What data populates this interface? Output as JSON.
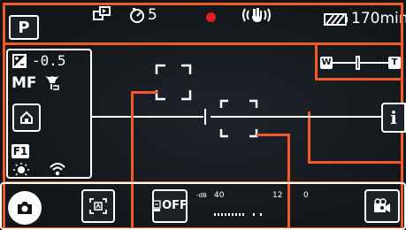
{
  "header": {
    "mode": "P",
    "self_timer": "5",
    "battery_time": "170min"
  },
  "left_panel": {
    "exposure_value": "-0.5",
    "focus_mode": "MF",
    "flash_label": "F1"
  },
  "zoom": {
    "wide_label": "W",
    "tele_label": "T"
  },
  "info_button": {
    "label": "i"
  },
  "bottom": {
    "audio_unit": "-dB",
    "audio_40": "40",
    "audio_12": "12",
    "audio_0": "0",
    "off_label": "OFF"
  },
  "icons": [
    "slow-motion-icon",
    "self-timer-icon",
    "record-dot-icon",
    "stabilizer-icon",
    "battery-icon",
    "exposure-comp-icon",
    "macro-icon",
    "home-icon",
    "flash-icon",
    "white-balance-icon",
    "wifi-icon",
    "zoom-bar-icon",
    "info-icon",
    "shutter-icon",
    "face-detect-icon",
    "timecode-off-icon",
    "audio-level-icon",
    "scene-select-icon"
  ],
  "colors": {
    "accent": "#f15a24",
    "record": "#e31c23",
    "frame_bg": "#161b20"
  }
}
